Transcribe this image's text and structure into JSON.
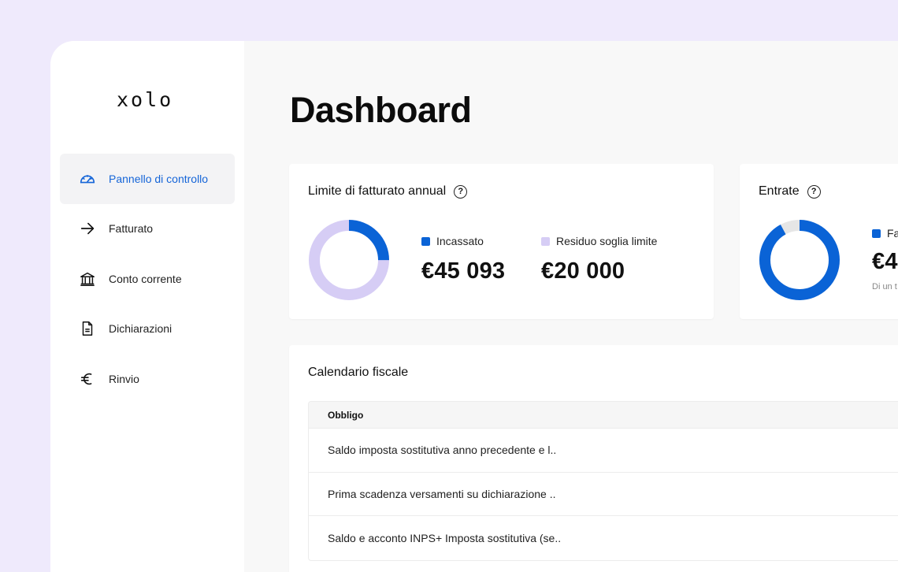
{
  "app": {
    "logo": "xolo"
  },
  "sidebar": {
    "items": [
      {
        "label": "Pannello di controllo",
        "icon": "speedometer-icon",
        "active": true
      },
      {
        "label": "Fatturato",
        "icon": "arrow-right-icon"
      },
      {
        "label": "Conto corrente",
        "icon": "bank-icon"
      },
      {
        "label": "Dichiarazioni",
        "icon": "document-icon"
      },
      {
        "label": "Rinvio",
        "icon": "euro-icon"
      }
    ]
  },
  "page": {
    "title": "Dashboard"
  },
  "limit_card": {
    "title": "Limite di fatturato annual",
    "legend": [
      {
        "label": "Incassato",
        "color": "#0a63d6",
        "value": "€45 093"
      },
      {
        "label": "Residuo soglia limite",
        "color": "#d6cdf5",
        "value": "€20 000"
      }
    ],
    "donut_fraction": 0.25
  },
  "income_card": {
    "title": "Entrate",
    "legend_label": "Fa",
    "amount": "€4",
    "subtitle": "Di un t",
    "donut_fraction": 0.92,
    "colors": {
      "primary": "#0a63d6",
      "rest": "#e6e6e6"
    }
  },
  "calendar": {
    "title": "Calendario fiscale",
    "column_header": "Obbligo",
    "rows": [
      "Saldo imposta sostitutiva anno precedente e l..",
      "Prima scadenza versamenti su dichiarazione ..",
      "Saldo e acconto INPS+ Imposta sostitutiva (se.."
    ]
  },
  "colors": {
    "accent": "#1565d8",
    "background": "#efeafc"
  }
}
